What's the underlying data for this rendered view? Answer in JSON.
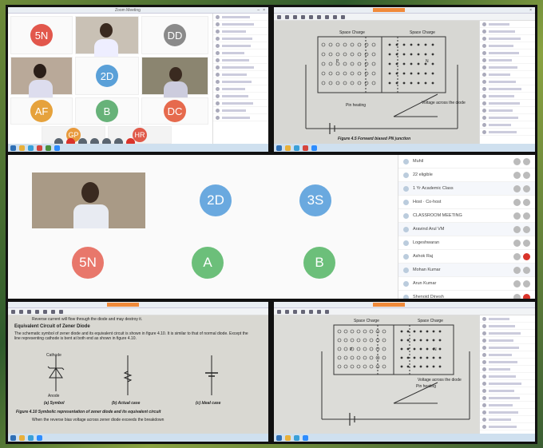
{
  "colors": {
    "accent": "#d9342b",
    "initial_text": "#ffffff",
    "taskbar": "#cfe0ef"
  },
  "top_left": {
    "window_title": "Zoom Meeting",
    "tiles": [
      {
        "initials": "5N",
        "color": "#e2574c"
      },
      {
        "initials": "DD",
        "color": "#8a8a8a"
      },
      {
        "initials": "2D",
        "color": "#5aa0d8"
      },
      {
        "initials": "AF",
        "color": "#e6a23c"
      },
      {
        "initials": "B",
        "color": "#67b279"
      },
      {
        "initials": "DC",
        "color": "#e66a4d"
      },
      {
        "initials": "GP",
        "color": "#e89a3c"
      },
      {
        "initials": "HR",
        "color": "#e05a4a"
      }
    ]
  },
  "top_right": {
    "figure_labels": [
      "Space Charge",
      "Space Charge",
      "P",
      "N"
    ],
    "annotation": "Voltage across the diode",
    "side_label": "Pin heating",
    "caption": "Figure 4.5 Forward biased PN junction"
  },
  "middle": {
    "tiles": [
      {
        "initials": "2D",
        "color": "#6aa9df"
      },
      {
        "initials": "3S",
        "color": "#6aa9df"
      },
      {
        "initials": "5N",
        "color": "#e8776b"
      },
      {
        "initials": "A",
        "color": "#6cbf7a"
      },
      {
        "initials": "B",
        "color": "#6cbf7a"
      }
    ],
    "participants": [
      {
        "label": "Muhil"
      },
      {
        "label": "22 eligible"
      },
      {
        "label": "1 Yr Academic Class"
      },
      {
        "label": "Host · Co-host"
      },
      {
        "label": "CLASSROOM MEETING"
      },
      {
        "label": "Aravind Arul VM"
      },
      {
        "label": "Logeshwaran"
      },
      {
        "label": "Ashok Raj"
      },
      {
        "label": "Mohan Kumar"
      },
      {
        "label": "Arun Kumar"
      },
      {
        "label": "Shenoid Dinesh"
      }
    ]
  },
  "bottom_left": {
    "line1": "Reverse current will flow through the diode and may destroy it.",
    "heading": "Equivalent Circuit of Zener Diode",
    "para": "The schematic symbol of zener diode and its equivalent circuit is shown in figure 4.10. It is similar to that of normal diode. Except the line representing cathode is bent at both end as shown in figure 4.10.",
    "cathode": "Cathode",
    "anode": "Anode",
    "sub_a": "(a) Symbol",
    "sub_b": "(b) Actual case",
    "sub_c": "(c) Ideal case",
    "caption": "Figure 4.10 Symbolic representation of zener diode and its equivalent circuit",
    "footer": "When the reverse bias voltage across zener diode exceeds the breakdown"
  },
  "bottom_right": {
    "figure_labels": [
      "Space Charge",
      "Space Charge",
      "P",
      "N"
    ],
    "annotation": "Voltage across the diode",
    "side_label": "Pin heating"
  }
}
